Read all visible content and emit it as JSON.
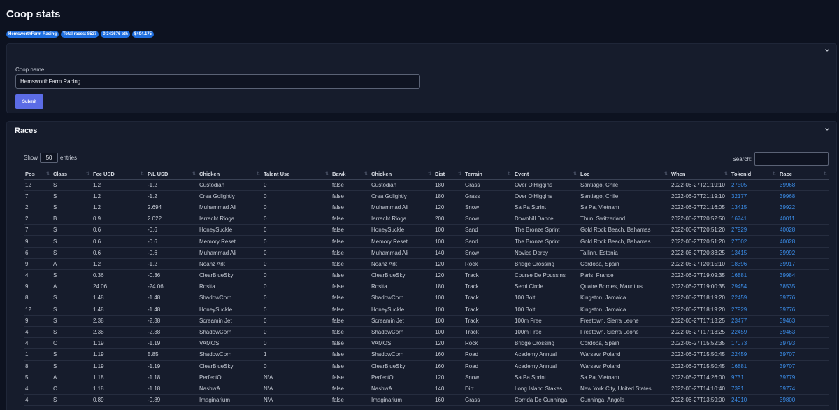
{
  "page": {
    "title": "Coop stats"
  },
  "badges": [
    "HemsworthFarm Racing",
    "Total races: 8537",
    "0.343676 eth",
    "$404.175"
  ],
  "coop_form": {
    "label": "Coop name",
    "value": "HemsworthFarm Racing",
    "submit_label": "Submit"
  },
  "races": {
    "title": "Races",
    "show_label": "Show",
    "entries_value": "50",
    "entries_label": "entries",
    "search_label": "Search:",
    "columns": [
      "Pos",
      "Class",
      "Fee USD",
      "P/L USD",
      "Chicken",
      "Talent Use",
      "Bawk",
      "Chicken",
      "Dist",
      "Terrain",
      "Event",
      "Loc",
      "When",
      "TokenId",
      "Race"
    ],
    "rows": [
      [
        "12",
        "S",
        "1.2",
        "-1.2",
        "Custodian",
        "0",
        "false",
        "Custodian",
        "180",
        "Grass",
        "Over O'Higgins",
        "Santiago, Chile",
        "2022-06-27T21:19:10",
        "27505",
        "39968"
      ],
      [
        "7",
        "S",
        "1.2",
        "-1.2",
        "Crea Golightly",
        "0",
        "false",
        "Crea Golightly",
        "180",
        "Grass",
        "Over O'Higgins",
        "Santiago, Chile",
        "2022-06-27T21:19:10",
        "32177",
        "39968"
      ],
      [
        "2",
        "S",
        "1.2",
        "2.694",
        "Muhammad Ali",
        "0",
        "false",
        "Muhammad Ali",
        "120",
        "Snow",
        "Sa Pa Sprint",
        "Sa Pa, Vietnam",
        "2022-06-27T21:16:05",
        "13415",
        "39922"
      ],
      [
        "2",
        "B",
        "0.9",
        "2.022",
        "Iarracht Rioga",
        "0",
        "false",
        "Iarracht Rioga",
        "200",
        "Snow",
        "Downhill Dance",
        "Thun, Switzerland",
        "2022-06-27T20:52:50",
        "16741",
        "40011"
      ],
      [
        "7",
        "S",
        "0.6",
        "-0.6",
        "HoneySuckle",
        "0",
        "false",
        "HoneySuckle",
        "100",
        "Sand",
        "The Bronze Sprint",
        "Gold Rock Beach, Bahamas",
        "2022-06-27T20:51:20",
        "27929",
        "40028"
      ],
      [
        "9",
        "S",
        "0.6",
        "-0.6",
        "Memory Reset",
        "0",
        "false",
        "Memory Reset",
        "100",
        "Sand",
        "The Bronze Sprint",
        "Gold Rock Beach, Bahamas",
        "2022-06-27T20:51:20",
        "27002",
        "40028"
      ],
      [
        "6",
        "S",
        "0.6",
        "-0.6",
        "Muhammad Ali",
        "0",
        "false",
        "Muhammad Ali",
        "140",
        "Snow",
        "Novice Derby",
        "Tallinn, Estonia",
        "2022-06-27T20:33:25",
        "13415",
        "39992"
      ],
      [
        "9",
        "A",
        "1.2",
        "-1.2",
        "Noahz Ark",
        "0",
        "false",
        "Noahz Ark",
        "120",
        "Rock",
        "Bridge Crossing",
        "Córdoba, Spain",
        "2022-06-27T20:15:10",
        "18396",
        "39917"
      ],
      [
        "4",
        "S",
        "0.36",
        "-0.36",
        "ClearBlueSky",
        "0",
        "false",
        "ClearBlueSky",
        "120",
        "Track",
        "Course De Poussins",
        "Paris, France",
        "2022-06-27T19:09:35",
        "16881",
        "39984"
      ],
      [
        "9",
        "A",
        "24.06",
        "-24.06",
        "Rosita",
        "0",
        "false",
        "Rosita",
        "180",
        "Track",
        "Semi Circle",
        "Quatre Bornes, Mauritius",
        "2022-06-27T19:00:35",
        "29454",
        "38535"
      ],
      [
        "8",
        "S",
        "1.48",
        "-1.48",
        "ShadowCorn",
        "0",
        "false",
        "ShadowCorn",
        "100",
        "Track",
        "100 Bolt",
        "Kingston, Jamaica",
        "2022-06-27T18:19:20",
        "22459",
        "39776"
      ],
      [
        "12",
        "S",
        "1.48",
        "-1.48",
        "HoneySuckle",
        "0",
        "false",
        "HoneySuckle",
        "100",
        "Track",
        "100 Bolt",
        "Kingston, Jamaica",
        "2022-06-27T18:19:20",
        "27929",
        "39776"
      ],
      [
        "9",
        "S",
        "2.38",
        "-2.38",
        "Screamin Jet",
        "0",
        "false",
        "Screamin Jet",
        "100",
        "Track",
        "100m Free",
        "Freetown, Sierra Leone",
        "2022-06-27T17:13:25",
        "23477",
        "39463"
      ],
      [
        "4",
        "S",
        "2.38",
        "-2.38",
        "ShadowCorn",
        "0",
        "false",
        "ShadowCorn",
        "100",
        "Track",
        "100m Free",
        "Freetown, Sierra Leone",
        "2022-06-27T17:13:25",
        "22459",
        "39463"
      ],
      [
        "4",
        "C",
        "1.19",
        "-1.19",
        "VAMOS",
        "0",
        "false",
        "VAMOS",
        "120",
        "Rock",
        "Bridge Crossing",
        "Córdoba, Spain",
        "2022-06-27T15:52:35",
        "17073",
        "39793"
      ],
      [
        "1",
        "S",
        "1.19",
        "5.85",
        "ShadowCorn",
        "1",
        "false",
        "ShadowCorn",
        "160",
        "Road",
        "Academy Annual",
        "Warsaw, Poland",
        "2022-06-27T15:50:45",
        "22459",
        "39707"
      ],
      [
        "8",
        "S",
        "1.19",
        "-1.19",
        "ClearBlueSky",
        "0",
        "false",
        "ClearBlueSky",
        "160",
        "Road",
        "Academy Annual",
        "Warsaw, Poland",
        "2022-06-27T15:50:45",
        "16881",
        "39707"
      ],
      [
        "5",
        "A",
        "1.18",
        "-1.18",
        "PerfectO",
        "N/A",
        "false",
        "PerfectO",
        "120",
        "Snow",
        "Sa Pa Sprint",
        "Sa Pa, Vietnam",
        "2022-06-27T14:26:00",
        "9731",
        "39779"
      ],
      [
        "4",
        "C",
        "1.18",
        "-1.18",
        "NashwA",
        "N/A",
        "false",
        "NashwA",
        "140",
        "Dirt",
        "Long Island Stakes",
        "New York City, United States",
        "2022-06-27T14:10:40",
        "7391",
        "39774"
      ],
      [
        "4",
        "S",
        "0.89",
        "-0.89",
        "Imaginarium",
        "N/A",
        "false",
        "Imaginarium",
        "160",
        "Grass",
        "Corrida De Cunhinga",
        "Cunhinga, Angola",
        "2022-06-27T13:59:00",
        "24910",
        "39800"
      ]
    ]
  }
}
